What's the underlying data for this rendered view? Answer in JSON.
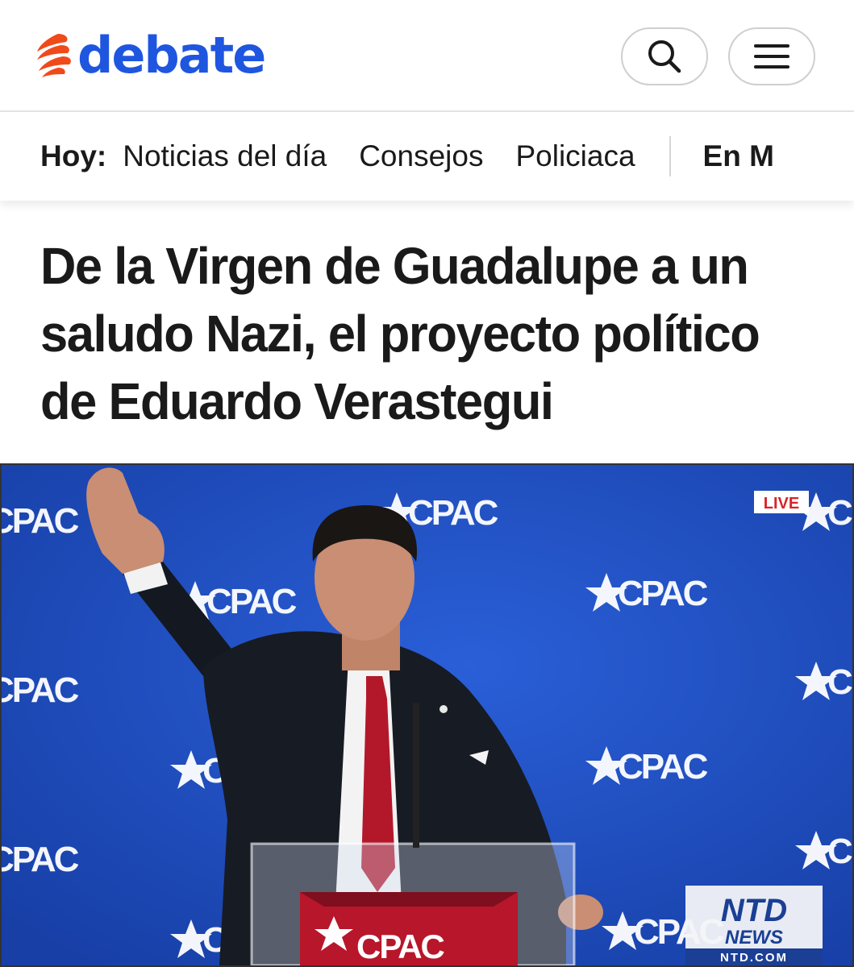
{
  "header": {
    "logo_text": "debate",
    "brand_color": "#1f56e0",
    "logo_mark_color": "#f04a1b",
    "search_icon": "search-icon",
    "menu_icon": "hamburger-menu-icon"
  },
  "nav": {
    "label": "Hoy:",
    "items": [
      {
        "label": "Noticias del día"
      },
      {
        "label": "Consejos"
      },
      {
        "label": "Policiaca"
      }
    ],
    "live_label": "En M"
  },
  "article": {
    "headline": "De la Virgen de Guadalupe a un saludo Nazi, el proyecto político de Eduardo Verastegui"
  },
  "hero_image": {
    "backdrop_word": "CPAC",
    "live_badge": "LIVE",
    "network_logo_top": "NTD",
    "network_logo_bottom": "NEWS",
    "network_url": "NTD.COM",
    "backdrop_color": "#2352c9",
    "live_color": "#d9232a"
  }
}
